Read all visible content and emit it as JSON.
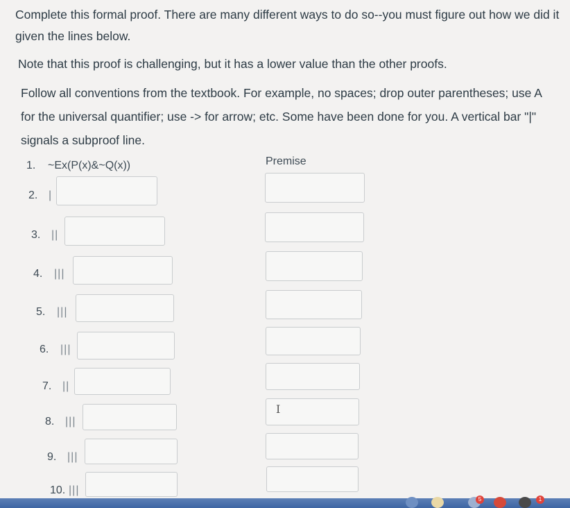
{
  "instructions": {
    "paragraph1": "Complete this formal proof. There are many different ways to do so--you must figure out how we did it given the lines below.",
    "paragraph2": "Note that this proof is challenging, but it has a lower value than the other proofs.",
    "paragraph3": "Follow all conventions from the textbook. For example, no spaces; drop outer parentheses; use A for the universal quantifier; use -> for arrow; etc. Some have been done for you. A vertical bar \"|\" signals a subproof line."
  },
  "proof": {
    "premise_line": {
      "number": "1.",
      "statement": "~Ex(P(x)&~Q(x))",
      "rule": "Premise"
    },
    "lines": [
      {
        "number": "2.",
        "bars": "|",
        "statement": "",
        "rule": ""
      },
      {
        "number": "3.",
        "bars": "||",
        "statement": "",
        "rule": ""
      },
      {
        "number": "4.",
        "bars": "|||",
        "statement": "",
        "rule": ""
      },
      {
        "number": "5.",
        "bars": "|||",
        "statement": "",
        "rule": ""
      },
      {
        "number": "6.",
        "bars": "|||",
        "statement": "",
        "rule": ""
      },
      {
        "number": "7.",
        "bars": "||",
        "statement": "",
        "rule": ""
      },
      {
        "number": "8.",
        "bars": "|||",
        "statement": "",
        "rule": ""
      },
      {
        "number": "9.",
        "bars": "|||",
        "statement": "",
        "rule": ""
      },
      {
        "number": "10.",
        "bars": "|||",
        "statement": "",
        "rule": ""
      }
    ]
  },
  "taskbar": {
    "badge_a": "5",
    "badge_b": "1"
  }
}
